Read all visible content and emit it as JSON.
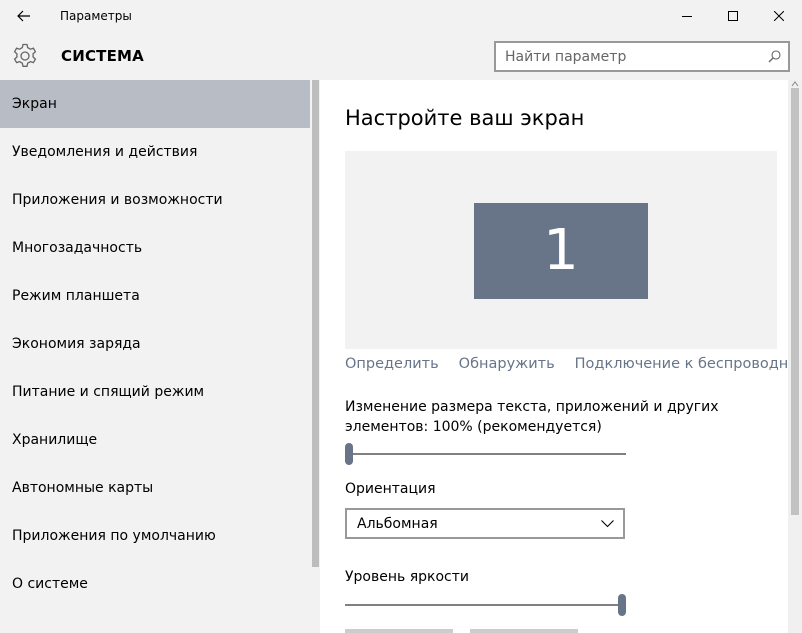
{
  "window": {
    "title": "Параметры",
    "controls": {
      "minimize": "minimize-icon",
      "maximize": "maximize-icon",
      "close": "close-icon"
    },
    "back_icon": "back-arrow-icon"
  },
  "header": {
    "icon": "gear-icon",
    "title": "СИСТЕМА"
  },
  "search": {
    "placeholder": "Найти параметр",
    "value": "",
    "icon": "search-icon"
  },
  "sidebar": {
    "items": [
      {
        "label": "Экран",
        "active": true
      },
      {
        "label": "Уведомления и действия"
      },
      {
        "label": "Приложения и возможности"
      },
      {
        "label": "Многозадачность"
      },
      {
        "label": "Режим планшета"
      },
      {
        "label": "Экономия заряда"
      },
      {
        "label": "Питание и спящий режим"
      },
      {
        "label": "Хранилище"
      },
      {
        "label": "Автономные карты"
      },
      {
        "label": "Приложения по умолчанию"
      },
      {
        "label": "О системе"
      }
    ]
  },
  "main": {
    "title": "Настройте ваш экран",
    "display_number": "1",
    "links": [
      "Определить",
      "Обнаружить",
      "Подключение к беспроводному"
    ],
    "scale": {
      "label": "Изменение размера текста, приложений и других элементов: 100% (рекомендуется)",
      "value_fraction": 0.0
    },
    "orientation": {
      "label": "Ориентация",
      "selected": "Альбомная"
    },
    "brightness": {
      "label": "Уровень яркости",
      "value_fraction": 1.0
    }
  },
  "colors": {
    "accent": "#687487",
    "sidebar_active": "#b8bcc4",
    "link": "#677489",
    "background": "#f2f2f2",
    "content_bg": "#ffffff"
  }
}
